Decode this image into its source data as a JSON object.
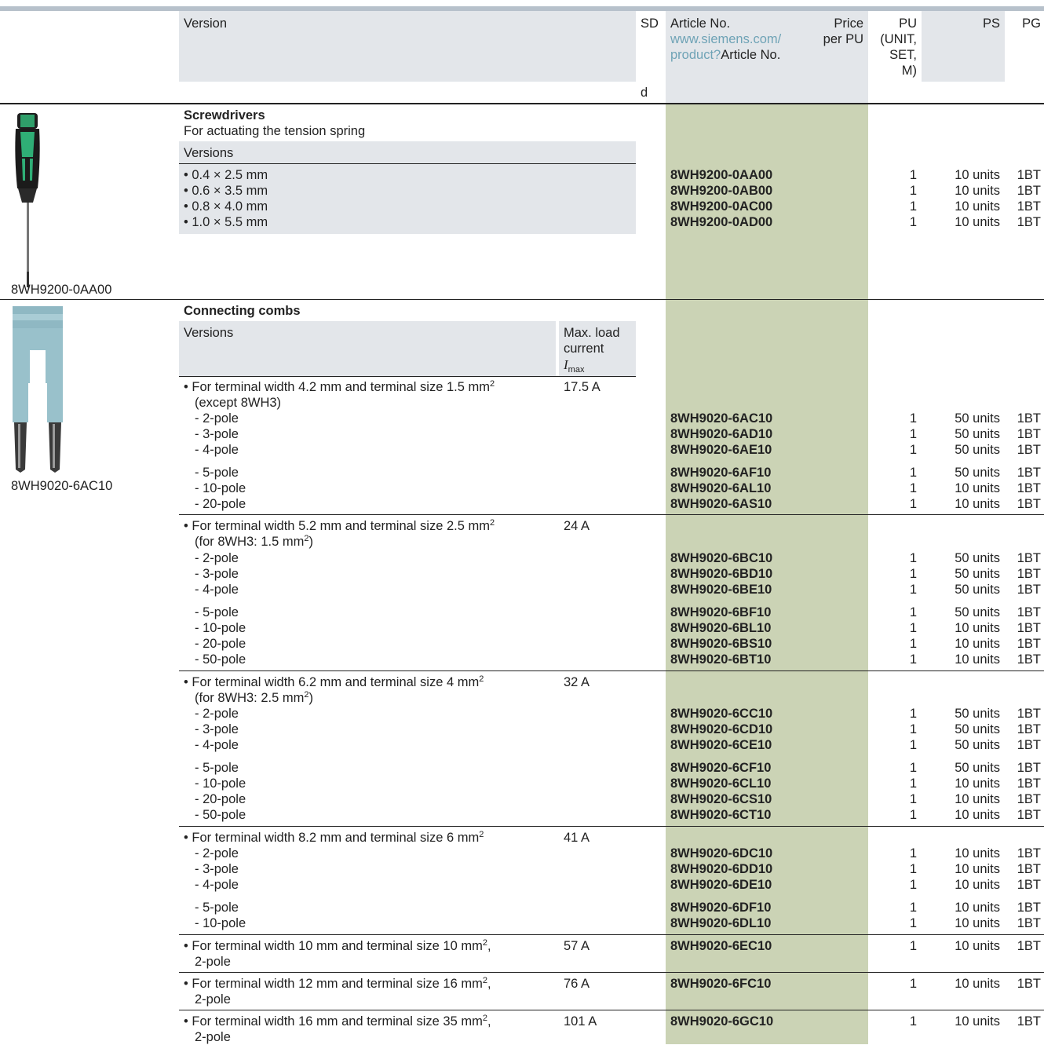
{
  "header": {
    "version": "Version",
    "sd": "SD",
    "sd_sub": "d",
    "article_no": "Article No.",
    "article_link": "www.siemens.com/",
    "article_link2": "product?",
    "article_link2_tail": "Article No.",
    "price1": "Price",
    "price2": "per PU",
    "pu_lines": [
      "PU",
      "(UNIT,",
      "SET,",
      "M)"
    ],
    "ps": "PS",
    "pg": "PG"
  },
  "screwdrivers": {
    "title": "Screwdrivers",
    "subtitle": "For actuating the tension spring",
    "versions_label": "Versions",
    "image_caption": "8WH9200-0AA00",
    "rows": [
      {
        "version": "• 0.4 × 2.5 mm",
        "article": "8WH9200-0AA00",
        "pu": "1",
        "ps": "10 units",
        "pg": "1BT"
      },
      {
        "version": "• 0.6 × 3.5 mm",
        "article": "8WH9200-0AB00",
        "pu": "1",
        "ps": "10 units",
        "pg": "1BT"
      },
      {
        "version": "• 0.8 × 4.0 mm",
        "article": "8WH9200-0AC00",
        "pu": "1",
        "ps": "10 units",
        "pg": "1BT"
      },
      {
        "version": "• 1.0 × 5.5 mm",
        "article": "8WH9200-0AD00",
        "pu": "1",
        "ps": "10 units",
        "pg": "1BT"
      }
    ]
  },
  "combs": {
    "title": "Connecting combs",
    "versions_label": "Versions",
    "maxload_label": [
      "Max. load",
      "current"
    ],
    "imax_label": "I",
    "imax_sub": "max",
    "image_caption": "8WH9020-6AC10",
    "groups": [
      {
        "desc1": "• For terminal width 4.2 mm and terminal size 1.5 mm",
        "desc1_sup": "2",
        "desc2": "(except 8WH3)",
        "desc2_sup": "",
        "desc2_tail": "",
        "current": "17.5 A",
        "rows": [
          {
            "pole": "-  2-pole",
            "article": "8WH9020-6AC10",
            "pu": "1",
            "ps": "50 units",
            "pg": "1BT"
          },
          {
            "pole": "-  3-pole",
            "article": "8WH9020-6AD10",
            "pu": "1",
            "ps": "50 units",
            "pg": "1BT"
          },
          {
            "pole": "-  4-pole",
            "article": "8WH9020-6AE10",
            "pu": "1",
            "ps": "50 units",
            "pg": "1BT"
          },
          {
            "pole": "-  5-pole",
            "article": "8WH9020-6AF10",
            "pu": "1",
            "ps": "50 units",
            "pg": "1BT"
          },
          {
            "pole": "-  10-pole",
            "article": "8WH9020-6AL10",
            "pu": "1",
            "ps": "10 units",
            "pg": "1BT"
          },
          {
            "pole": "-  20-pole",
            "article": "8WH9020-6AS10",
            "pu": "1",
            "ps": "10 units",
            "pg": "1BT"
          }
        ]
      },
      {
        "desc1": "• For terminal width 5.2 mm and terminal size 2.5 mm",
        "desc1_sup": "2",
        "desc2": "(for 8WH3: 1.5 mm",
        "desc2_sup": "2",
        "desc2_tail": ")",
        "current": "24 A",
        "rows": [
          {
            "pole": "-  2-pole",
            "article": "8WH9020-6BC10",
            "pu": "1",
            "ps": "50 units",
            "pg": "1BT"
          },
          {
            "pole": "-  3-pole",
            "article": "8WH9020-6BD10",
            "pu": "1",
            "ps": "50 units",
            "pg": "1BT"
          },
          {
            "pole": "-  4-pole",
            "article": "8WH9020-6BE10",
            "pu": "1",
            "ps": "50 units",
            "pg": "1BT"
          },
          {
            "pole": "-  5-pole",
            "article": "8WH9020-6BF10",
            "pu": "1",
            "ps": "50 units",
            "pg": "1BT"
          },
          {
            "pole": "-  10-pole",
            "article": "8WH9020-6BL10",
            "pu": "1",
            "ps": "10 units",
            "pg": "1BT"
          },
          {
            "pole": "-  20-pole",
            "article": "8WH9020-6BS10",
            "pu": "1",
            "ps": "10 units",
            "pg": "1BT"
          },
          {
            "pole": "-  50-pole",
            "article": "8WH9020-6BT10",
            "pu": "1",
            "ps": "10 units",
            "pg": "1BT"
          }
        ]
      },
      {
        "desc1": "• For terminal width 6.2 mm and terminal size 4 mm",
        "desc1_sup": "2",
        "desc2": "(for 8WH3: 2.5 mm",
        "desc2_sup": "2",
        "desc2_tail": ")",
        "current": "32 A",
        "rows": [
          {
            "pole": "-  2-pole",
            "article": "8WH9020-6CC10",
            "pu": "1",
            "ps": "50 units",
            "pg": "1BT"
          },
          {
            "pole": "-  3-pole",
            "article": "8WH9020-6CD10",
            "pu": "1",
            "ps": "50 units",
            "pg": "1BT"
          },
          {
            "pole": "-  4-pole",
            "article": "8WH9020-6CE10",
            "pu": "1",
            "ps": "50 units",
            "pg": "1BT"
          },
          {
            "pole": "-  5-pole",
            "article": "8WH9020-6CF10",
            "pu": "1",
            "ps": "50 units",
            "pg": "1BT"
          },
          {
            "pole": "-  10-pole",
            "article": "8WH9020-6CL10",
            "pu": "1",
            "ps": "10 units",
            "pg": "1BT"
          },
          {
            "pole": "-  20-pole",
            "article": "8WH9020-6CS10",
            "pu": "1",
            "ps": "10 units",
            "pg": "1BT"
          },
          {
            "pole": "-  50-pole",
            "article": "8WH9020-6CT10",
            "pu": "1",
            "ps": "10 units",
            "pg": "1BT"
          }
        ]
      },
      {
        "desc1": "• For terminal width 8.2 mm and terminal size 6 mm",
        "desc1_sup": "2",
        "current": "41 A",
        "rows": [
          {
            "pole": "-  2-pole",
            "article": "8WH9020-6DC10",
            "pu": "1",
            "ps": "10 units",
            "pg": "1BT"
          },
          {
            "pole": "-  3-pole",
            "article": "8WH9020-6DD10",
            "pu": "1",
            "ps": "10 units",
            "pg": "1BT"
          },
          {
            "pole": "-  4-pole",
            "article": "8WH9020-6DE10",
            "pu": "1",
            "ps": "10 units",
            "pg": "1BT"
          },
          {
            "pole": "-  5-pole",
            "article": "8WH9020-6DF10",
            "pu": "1",
            "ps": "10 units",
            "pg": "1BT"
          },
          {
            "pole": "-  10-pole",
            "article": "8WH9020-6DL10",
            "pu": "1",
            "ps": "10 units",
            "pg": "1BT"
          }
        ]
      },
      {
        "desc1": "• For terminal width 10 mm and terminal size 10 mm",
        "desc1_sup": "2",
        "desc1_tail": ",",
        "desc2": "2-pole",
        "current": "57 A",
        "article": "8WH9020-6EC10",
        "pu": "1",
        "ps": "10 units",
        "pg": "1BT"
      },
      {
        "desc1": "• For terminal width 12 mm and terminal size 16 mm",
        "desc1_sup": "2",
        "desc1_tail": ",",
        "desc2": "2-pole",
        "current": "76 A",
        "article": "8WH9020-6FC10",
        "pu": "1",
        "ps": "10 units",
        "pg": "1BT"
      },
      {
        "desc1": "• For terminal width 16 mm and terminal size 35 mm",
        "desc1_sup": "2",
        "desc1_tail": ",",
        "desc2": "2-pole",
        "current": "101 A",
        "article": "8WH9020-6GC10",
        "pu": "1",
        "ps": "10 units",
        "pg": "1BT"
      }
    ]
  }
}
